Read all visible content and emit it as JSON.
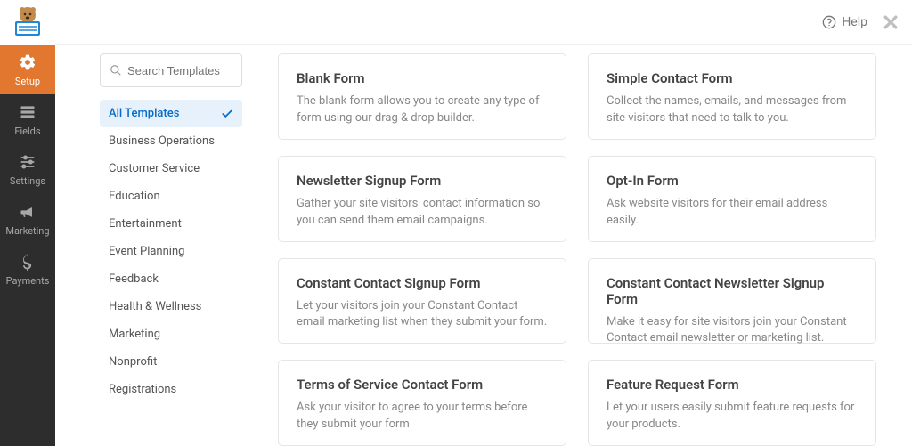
{
  "topbar": {
    "help": "Help"
  },
  "nav": {
    "items": [
      {
        "label": "Setup"
      },
      {
        "label": "Fields"
      },
      {
        "label": "Settings"
      },
      {
        "label": "Marketing"
      },
      {
        "label": "Payments"
      }
    ]
  },
  "search": {
    "placeholder": "Search Templates"
  },
  "categories": [
    {
      "label": "All Templates",
      "active": true
    },
    {
      "label": "Business Operations"
    },
    {
      "label": "Customer Service"
    },
    {
      "label": "Education"
    },
    {
      "label": "Entertainment"
    },
    {
      "label": "Event Planning"
    },
    {
      "label": "Feedback"
    },
    {
      "label": "Health & Wellness"
    },
    {
      "label": "Marketing"
    },
    {
      "label": "Nonprofit"
    },
    {
      "label": "Registrations"
    }
  ],
  "templates": [
    {
      "title": "Blank Form",
      "desc": "The blank form allows you to create any type of form using our drag & drop builder."
    },
    {
      "title": "Simple Contact Form",
      "desc": "Collect the names, emails, and messages from site visitors that need to talk to you."
    },
    {
      "title": "Newsletter Signup Form",
      "desc": "Gather your site visitors' contact information so you can send them email campaigns."
    },
    {
      "title": "Opt-In Form",
      "desc": "Ask website visitors for their email address easily."
    },
    {
      "title": "Constant Contact Signup Form",
      "desc": "Let your visitors join your Constant Contact email marketing list when they submit your form."
    },
    {
      "title": "Constant Contact Newsletter Signup Form",
      "desc": "Make it easy for site visitors join your Constant Contact email newsletter or marketing list."
    },
    {
      "title": "Terms of Service Contact Form",
      "desc": "Ask your visitor to agree to your terms before they submit your form"
    },
    {
      "title": "Feature Request Form",
      "desc": "Let your users easily submit feature requests for your products."
    }
  ]
}
